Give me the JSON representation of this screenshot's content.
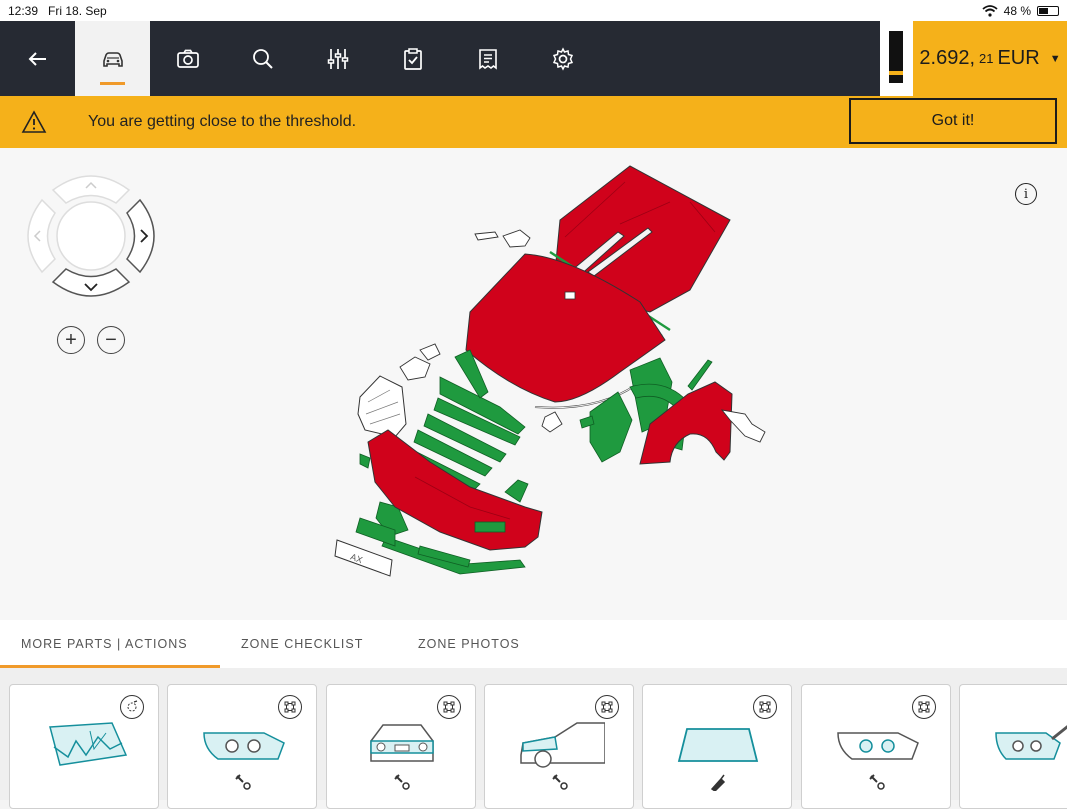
{
  "status": {
    "time": "12:39",
    "date": "Fri 18. Sep",
    "battery": "48 %",
    "battery_level": 0.48
  },
  "toolbar": {
    "items": [
      {
        "icon": "back-arrow-icon"
      },
      {
        "icon": "car-icon",
        "active": true
      },
      {
        "icon": "camera-icon"
      },
      {
        "icon": "search-icon"
      },
      {
        "icon": "sliders-icon"
      },
      {
        "icon": "clipboard-check-icon"
      },
      {
        "icon": "receipt-icon"
      },
      {
        "icon": "gear-icon"
      }
    ],
    "price_main": "2.692,",
    "price_cents": "21",
    "currency": "EUR"
  },
  "banner": {
    "message": "You are getting close to the threshold.",
    "button": "Got it!"
  },
  "diagram": {
    "plate": "AX",
    "colors": {
      "damaged": "#d0021b",
      "ok": "#1f9a3f",
      "outline": "#333333"
    }
  },
  "tabs": [
    {
      "label": "MORE PARTS | ACTIONS",
      "active": true
    },
    {
      "label": "ZONE CHECKLIST",
      "active": false
    },
    {
      "label": "ZONE PHOTOS",
      "active": false
    }
  ],
  "cards": [
    {
      "name": "windscreen-damage",
      "icon": "broken-glass-icon",
      "badge": "repair-badge-icon",
      "tool": ""
    },
    {
      "name": "headlight-left",
      "icon": "headlight-icon",
      "badge": "part-badge-icon",
      "tool": "wrench-icon"
    },
    {
      "name": "front-view",
      "icon": "car-front-icon",
      "badge": "part-badge-icon",
      "tool": "wrench-icon"
    },
    {
      "name": "side-view",
      "icon": "car-side-icon",
      "badge": "part-badge-icon",
      "tool": "wrench-icon"
    },
    {
      "name": "windscreen",
      "icon": "windscreen-icon",
      "badge": "part-badge-icon",
      "tool": "glue-icon"
    },
    {
      "name": "headlight-right",
      "icon": "headlight-icon",
      "badge": "part-badge-icon",
      "tool": "wrench-icon"
    },
    {
      "name": "headlight-tool",
      "icon": "headlight-icon",
      "badge": "",
      "tool": ""
    }
  ]
}
